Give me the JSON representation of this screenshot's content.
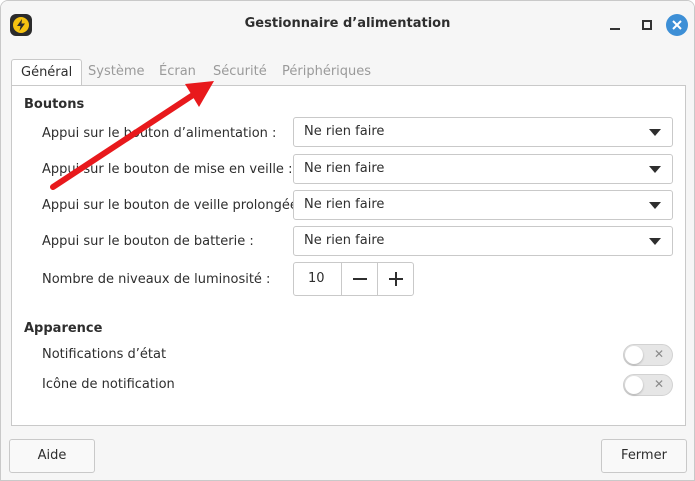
{
  "window": {
    "title": "Gestionnaire d’alimentation"
  },
  "tabs": [
    {
      "label": "Général",
      "active": true
    },
    {
      "label": "Système",
      "active": false
    },
    {
      "label": "Écran",
      "active": false
    },
    {
      "label": "Sécurité",
      "active": false
    },
    {
      "label": "Périphériques",
      "active": false
    }
  ],
  "buttons_section": {
    "title": "Boutons",
    "rows": [
      {
        "label": "Appui sur le bouton d’alimentation :",
        "value": "Ne rien faire"
      },
      {
        "label": "Appui sur le bouton de mise en veille :",
        "value": "Ne rien faire"
      },
      {
        "label": "Appui sur le bouton de veille prolongée :",
        "value": "Ne rien faire"
      },
      {
        "label": "Appui sur le bouton de batterie :",
        "value": "Ne rien faire"
      }
    ],
    "brightness": {
      "label": "Nombre de niveaux de luminosité :",
      "value": "10"
    }
  },
  "appearance_section": {
    "title": "Apparence",
    "toggles": [
      {
        "label": "Notifications d’état",
        "on": false
      },
      {
        "label": "Icône de notification",
        "on": false
      }
    ]
  },
  "footer": {
    "help_label": "Aide",
    "close_label": "Fermer"
  },
  "colors": {
    "accent": "#3d8fd6",
    "annotation_arrow": "#e8191c",
    "app_icon": "#f5c211"
  }
}
